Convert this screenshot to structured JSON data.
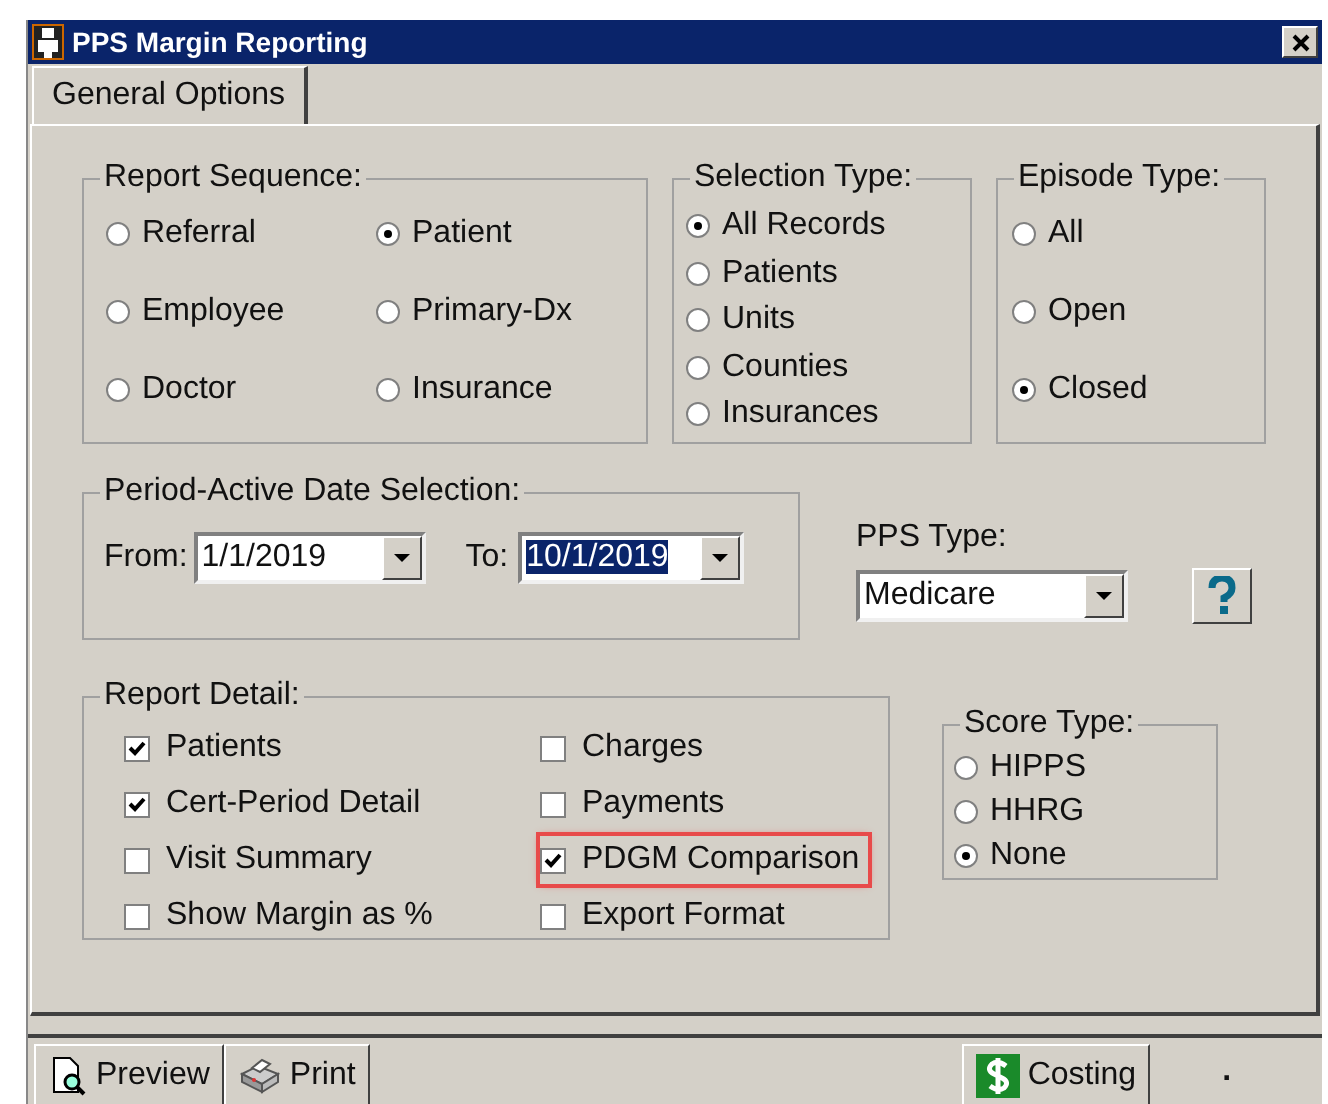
{
  "window": {
    "title": "PPS Margin Reporting"
  },
  "tabs": [
    {
      "label": "General Options",
      "selected": true
    }
  ],
  "report_sequence": {
    "title": "Report Sequence:",
    "options": [
      {
        "label": "Referral",
        "selected": false
      },
      {
        "label": "Patient",
        "selected": true
      },
      {
        "label": "Employee",
        "selected": false
      },
      {
        "label": "Primary-Dx",
        "selected": false
      },
      {
        "label": "Doctor",
        "selected": false
      },
      {
        "label": "Insurance",
        "selected": false
      }
    ]
  },
  "selection_type": {
    "title": "Selection Type:",
    "options": [
      {
        "label": "All Records",
        "selected": true
      },
      {
        "label": "Patients",
        "selected": false
      },
      {
        "label": "Units",
        "selected": false
      },
      {
        "label": "Counties",
        "selected": false
      },
      {
        "label": "Insurances",
        "selected": false
      }
    ]
  },
  "episode_type": {
    "title": "Episode Type:",
    "options": [
      {
        "label": "All",
        "selected": false
      },
      {
        "label": "Open",
        "selected": false
      },
      {
        "label": "Closed",
        "selected": true
      }
    ]
  },
  "period": {
    "title": "Period-Active Date Selection:",
    "from_label": "From:",
    "from_value": "1/1/2019",
    "to_label": "To:",
    "to_value": "10/1/2019"
  },
  "pps_type": {
    "label": "PPS Type:",
    "value": "Medicare"
  },
  "report_detail": {
    "title": "Report Detail:",
    "options": [
      {
        "label": "Patients",
        "checked": true,
        "highlighted": false
      },
      {
        "label": "Charges",
        "checked": false,
        "highlighted": false
      },
      {
        "label": "Cert-Period Detail",
        "checked": true,
        "highlighted": false
      },
      {
        "label": "Payments",
        "checked": false,
        "highlighted": false
      },
      {
        "label": "Visit Summary",
        "checked": false,
        "highlighted": false
      },
      {
        "label": "PDGM Comparison",
        "checked": true,
        "highlighted": true
      },
      {
        "label": "Show Margin as %",
        "checked": false,
        "highlighted": false
      },
      {
        "label": "Export Format",
        "checked": false,
        "highlighted": false
      }
    ]
  },
  "score_type": {
    "title": "Score Type:",
    "options": [
      {
        "label": "HIPPS",
        "selected": false
      },
      {
        "label": "HHRG",
        "selected": false
      },
      {
        "label": "None",
        "selected": true
      }
    ]
  },
  "toolbar": {
    "buttons": [
      {
        "label": "Preview",
        "kind": "preview"
      },
      {
        "label": "Print",
        "kind": "print"
      },
      {
        "label": "Costing",
        "kind": "costing"
      }
    ],
    "status": "."
  }
}
